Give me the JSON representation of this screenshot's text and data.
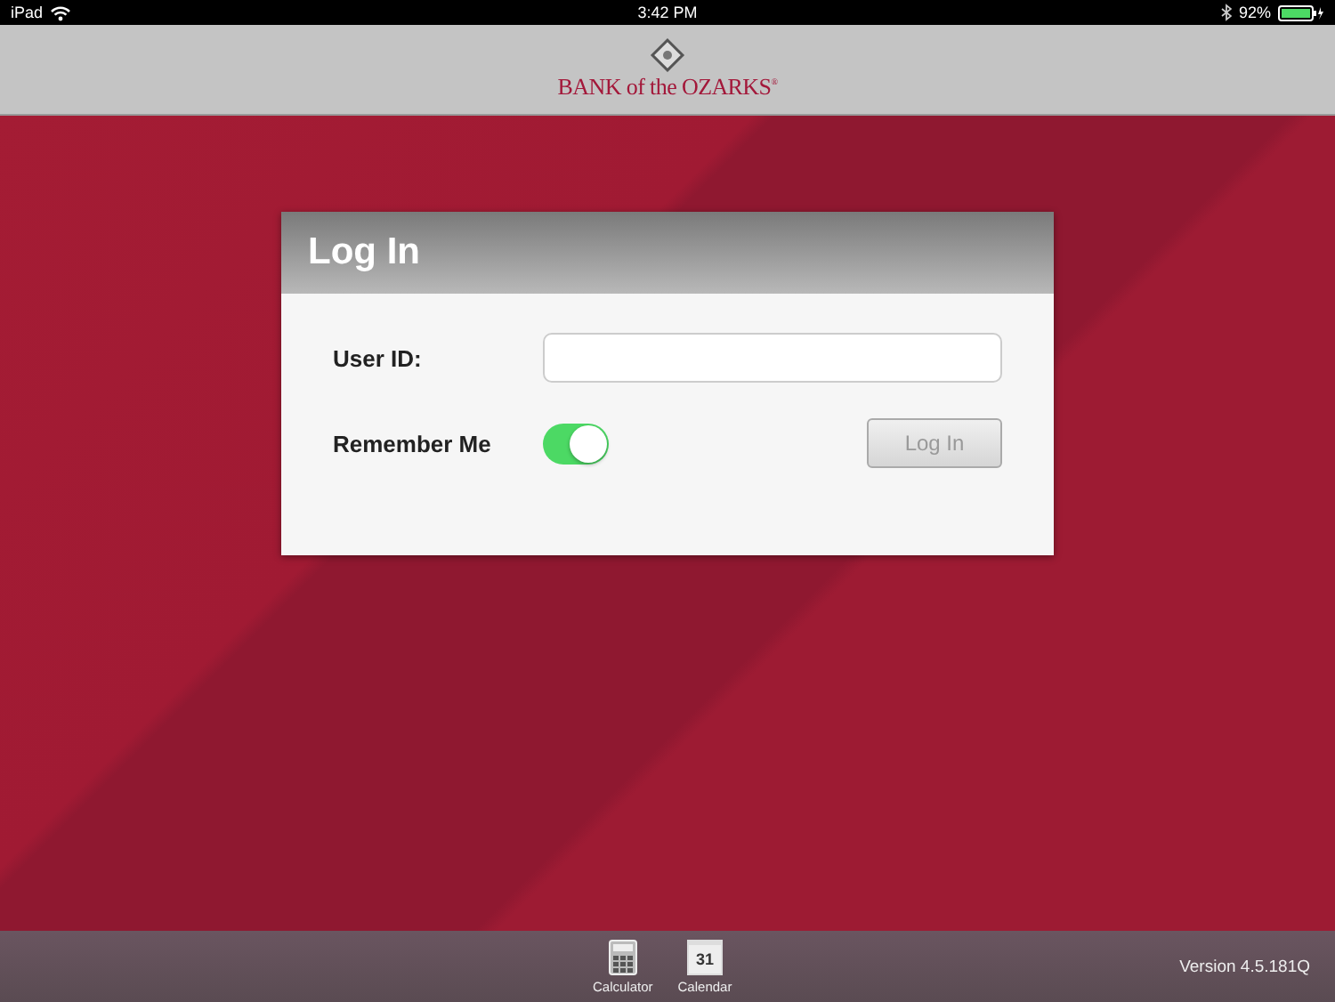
{
  "status_bar": {
    "device": "iPad",
    "time": "3:42 PM",
    "battery": "92%"
  },
  "header": {
    "logo": "BANK of the OZARKS$^{®}$"
  },
  "login": {
    "title": "Log In",
    "user_id_label": "User ID:",
    "remember_label": "Remember Me",
    "remember_on": true,
    "button": {
      "label": "Log In",
      "disabled": true
    }
  },
  "footer": {
    "tools": [
      {
        "kind": "calculator",
        "label": "Calculator"
      },
      {
        "kind": "calendar",
        "label": "Calendar",
        "day": "31"
      }
    ],
    "version": "Version 4.5.181Q"
  }
}
